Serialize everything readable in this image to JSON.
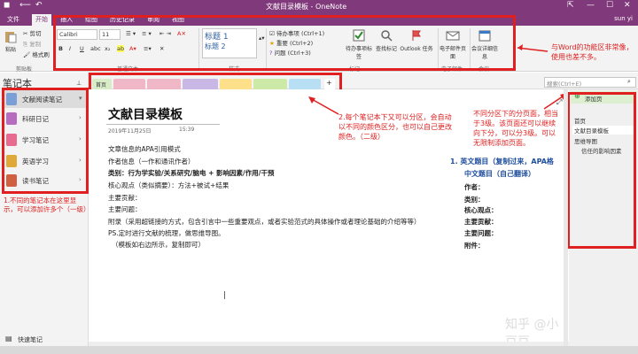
{
  "window": {
    "title": "文献目录模板 - OneNote",
    "user": "sun yi"
  },
  "ribbon_tabs": [
    "文件",
    "开始",
    "插入",
    "绘图",
    "历史记录",
    "审阅",
    "视图"
  ],
  "clipboard": {
    "paste": "粘贴",
    "cut": "剪切",
    "copy": "复制",
    "format_painter": "格式刷",
    "group": "剪贴板"
  },
  "font": {
    "name": "Calibri",
    "size": "11",
    "group": "普通文本"
  },
  "styles": {
    "heading1": "标题 1",
    "heading2": "标题 2",
    "group": "样式"
  },
  "tags": {
    "todo": "待办事项 (Ctrl+1)",
    "important": "重要 (Ctrl+2)",
    "question": "问题 (Ctrl+3)",
    "todo_tag": "待办事项标签",
    "find_tags": "查找标记",
    "outlook": "Outlook 任务",
    "group": "标记"
  },
  "email": {
    "label": "电子邮件页面",
    "group": "电子邮件"
  },
  "meeting": {
    "label": "会议详细信息",
    "group": "会议"
  },
  "search": {
    "placeholder": "搜索(Ctrl+E)"
  },
  "notebooks": {
    "title": "笔记本",
    "items": [
      {
        "label": "文献阅读笔记",
        "color": "#7a9ed6"
      },
      {
        "label": "科研日记",
        "color": "#b86cc0"
      },
      {
        "label": "学习笔记",
        "color": "#e86b8f"
      },
      {
        "label": "英语学习",
        "color": "#e0a838"
      },
      {
        "label": "读书笔记",
        "color": "#d06040"
      }
    ],
    "quick_notes": "快速笔记"
  },
  "section_tabs": [
    {
      "label": "首页",
      "color": "#d9ecc8"
    },
    {
      "label": "",
      "color": "#f0b7c7"
    },
    {
      "label": "",
      "color": "#f0b7c7"
    },
    {
      "label": "",
      "color": "#c9b8e6"
    },
    {
      "label": "",
      "color": "#ffe08a"
    },
    {
      "label": "",
      "color": "#cde9a8"
    },
    {
      "label": "",
      "color": "#b9dff5"
    },
    {
      "label": "+",
      "color": "#ffffff"
    }
  ],
  "page": {
    "title": "文献目录模板",
    "date": "2019年11月25日",
    "time": "15:39",
    "lines": [
      "文章信息的APA引用模式",
      "作者信息（一作和通讯作者）",
      "类别：行为学实验/关系研究/脑电 + 影响因素/作用/干预",
      "核心观点（类似摘要）：方法+被试+结果",
      "主要贡献：",
      "主要问题：",
      "附录（采用超链接的方式，包含引言中一些重要观点，或者实验范式的具体操作或者理论基础的介绍等等）",
      "PS.定时进行文献的梳理，做思维导图。",
      "（模板如右边所示，复制即可）"
    ],
    "right_block": {
      "line1": "1.  英文题目（复制过来，APA格",
      "line2": "中文题目（自己翻译）",
      "fields": [
        "作者：",
        "类别：",
        "核心观点：",
        "主要贡献：",
        "主要问题：",
        "附件："
      ]
    }
  },
  "pages_panel": {
    "add_page": "添加页",
    "items": [
      "首页",
      "文献目录模板",
      "思维导图",
      "信任的影响因素"
    ]
  },
  "annotations": {
    "ribbon": "与Word的功能区非常像，使用也差不多。",
    "notebook": "1.不同的笔记本在这里显示，可以添加许多个（一级）",
    "sections": "2.每个笔记本下又可以分区，会自动以不同的颜色区分，也可以自己更改颜色。（二级）",
    "pages": "不同分区下的分页面，相当于3级。该页面还可以继续向下分，可以分3级。可以无限制添加页面。"
  },
  "watermark": "知乎 @小豆豆"
}
